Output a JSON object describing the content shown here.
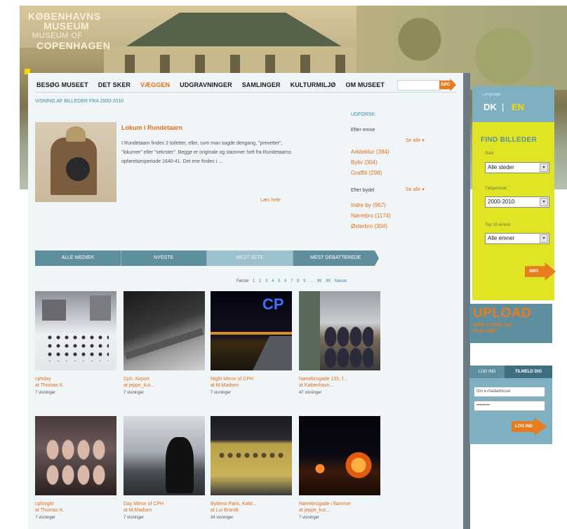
{
  "logo": {
    "line1": "KØBENHAVNS",
    "line2": "MUSEUM",
    "line3": "MUSEUM OF",
    "line4": "COPENHAGEN"
  },
  "nav": {
    "items": [
      "BESØG MUSEET",
      "DET SKER",
      "VÆGGEN",
      "UDGRAVNINGER",
      "SAMLINGER",
      "KULTURMILJØ",
      "OM MUSEET"
    ],
    "active_index": 2,
    "search_placeholder": "",
    "search_button": "SØG"
  },
  "breadcrumb": "VISNING AF BILLEDER FRA 2000-2010",
  "featured": {
    "title": "Lokum i Rundetaarn",
    "text": "I Rundetaarn findes 2 toiletter, eller, som man sagde dengang, \"prevetter\", \"lokumer\" eller \"sekrster\". Begge er originale og stammer helt fra Rundetaarns opførelsesperiode 1640-41. Det ene findes i ...",
    "more": "Læs hele"
  },
  "explore": {
    "heading": "UDFORSK:",
    "by_topic_label": "Efter emne",
    "by_topic_select": "Se alle",
    "topics": [
      "Arkitektur (384)",
      "Byliv (304)",
      "Graffiti (298)"
    ],
    "by_area_label": "Efter bydel",
    "by_area_select": "Se alle",
    "areas": [
      "Indre by (967)",
      "Nørrebro (1174)",
      "Østerbro (304)"
    ]
  },
  "tabs": [
    "ALLE MEDIER",
    "NYESTE",
    "MEST SETE",
    "MEST DEBATTEREDE"
  ],
  "tab_active": 2,
  "pager": {
    "label": "Første",
    "pages": [
      "1",
      "2",
      "3",
      "4",
      "5",
      "6",
      "7",
      "8",
      "9",
      "..."
    ],
    "next_a": "99",
    "next_b": "99",
    "last": "Næste"
  },
  "thumbs": [
    {
      "title": "cphday",
      "by": "at Thomas K.",
      "views": "7 visninger"
    },
    {
      "title": "Cph. Airport",
      "by": "at jeppe_kut...",
      "views": "7 visninger"
    },
    {
      "title": "Night Mirror of CPH",
      "by": "at M.Madsen",
      "views": "7 visninger"
    },
    {
      "title": "Nørrebrogade 155, f...",
      "by": "at København...",
      "views": "47 visninger"
    },
    {
      "title": "cphnight",
      "by": "at Thomas K.",
      "views": "7 visninger"
    },
    {
      "title": "Day Mirror of CPH",
      "by": "at M.Madsen",
      "views": "7 visninger"
    },
    {
      "title": "Byttens Paris, Købt...",
      "by": "at Lui Brandt",
      "views": "34 visninger"
    },
    {
      "title": "Nørrebrogade i flammer",
      "by": "at jeppe_kut...",
      "views": "7 visninger"
    }
  ],
  "language": {
    "label": "Language",
    "dk": "DK",
    "sep": "|",
    "en": "EN"
  },
  "finder": {
    "title": "FIND BILLEDER",
    "place_label": "Sted",
    "place_value": "Alle steder",
    "period_label": "Tidsperiode",
    "period_value": "2000-2010",
    "topic_label": "Top 10 emner",
    "topic_value": "Alle emner",
    "go": "SØG"
  },
  "upload": {
    "title": "UPLOAD",
    "sub1": "DINE FOTOS OG",
    "sub2": "FILM HER"
  },
  "login": {
    "tab_login": "LOG IND",
    "tab_signup": "TILMELD DIG",
    "user_value": "Din e-mailadresse",
    "password_value": "•••••••••",
    "go": "LOG IND"
  },
  "colors": {
    "orange": "#e0701c",
    "teal": "#5f8e9f",
    "yellow": "#dfe525"
  }
}
